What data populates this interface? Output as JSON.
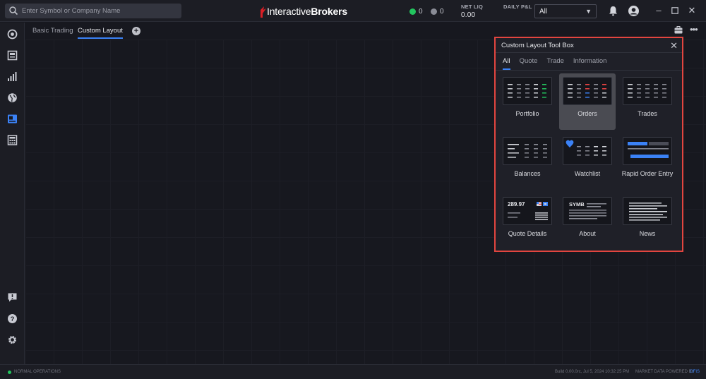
{
  "search": {
    "placeholder": "Enter Symbol or Company Name"
  },
  "brand": {
    "regular": "Interactive",
    "bold": "Brokers"
  },
  "indicators": [
    {
      "name": "green-count",
      "value": "0",
      "color": "#22c55e"
    },
    {
      "name": "gray-count",
      "value": "0",
      "color": "#8a8c96"
    }
  ],
  "stats": {
    "net_liq_label": "NET LIQ",
    "net_liq_value": "0.00",
    "daily_pl_label": "DAILY P&L",
    "daily_pl_value": ""
  },
  "account_select": {
    "value": "All"
  },
  "tabs": [
    {
      "label": "Basic Trading",
      "active": false
    },
    {
      "label": "Custom Layout",
      "active": true
    }
  ],
  "toolbox": {
    "title": "Custom Layout Tool Box",
    "tabs": [
      "All",
      "Quote",
      "Trade",
      "Information"
    ],
    "active_tab": "All",
    "widgets": [
      {
        "label": "Portfolio"
      },
      {
        "label": "Orders",
        "selected": true
      },
      {
        "label": "Trades"
      },
      {
        "label": "Balances"
      },
      {
        "label": "Watchlist"
      },
      {
        "label": "Rapid Order Entry"
      },
      {
        "label": "Quote Details",
        "thumb_text": "289.97"
      },
      {
        "label": "About",
        "thumb_text": "SYMB"
      },
      {
        "label": "News"
      }
    ]
  },
  "statusbar": {
    "status": "NORMAL OPERATIONS",
    "build": "Build 0.00.0rc, Jul 5, 2024 10:32:25 PM",
    "powered_by": "MARKET DATA POWERED BY",
    "provider": "GFIS"
  },
  "colors": {
    "accent": "#3b82f6",
    "highlight": "#e2453f",
    "positive": "#22c55e",
    "negative": "#ef4444"
  }
}
